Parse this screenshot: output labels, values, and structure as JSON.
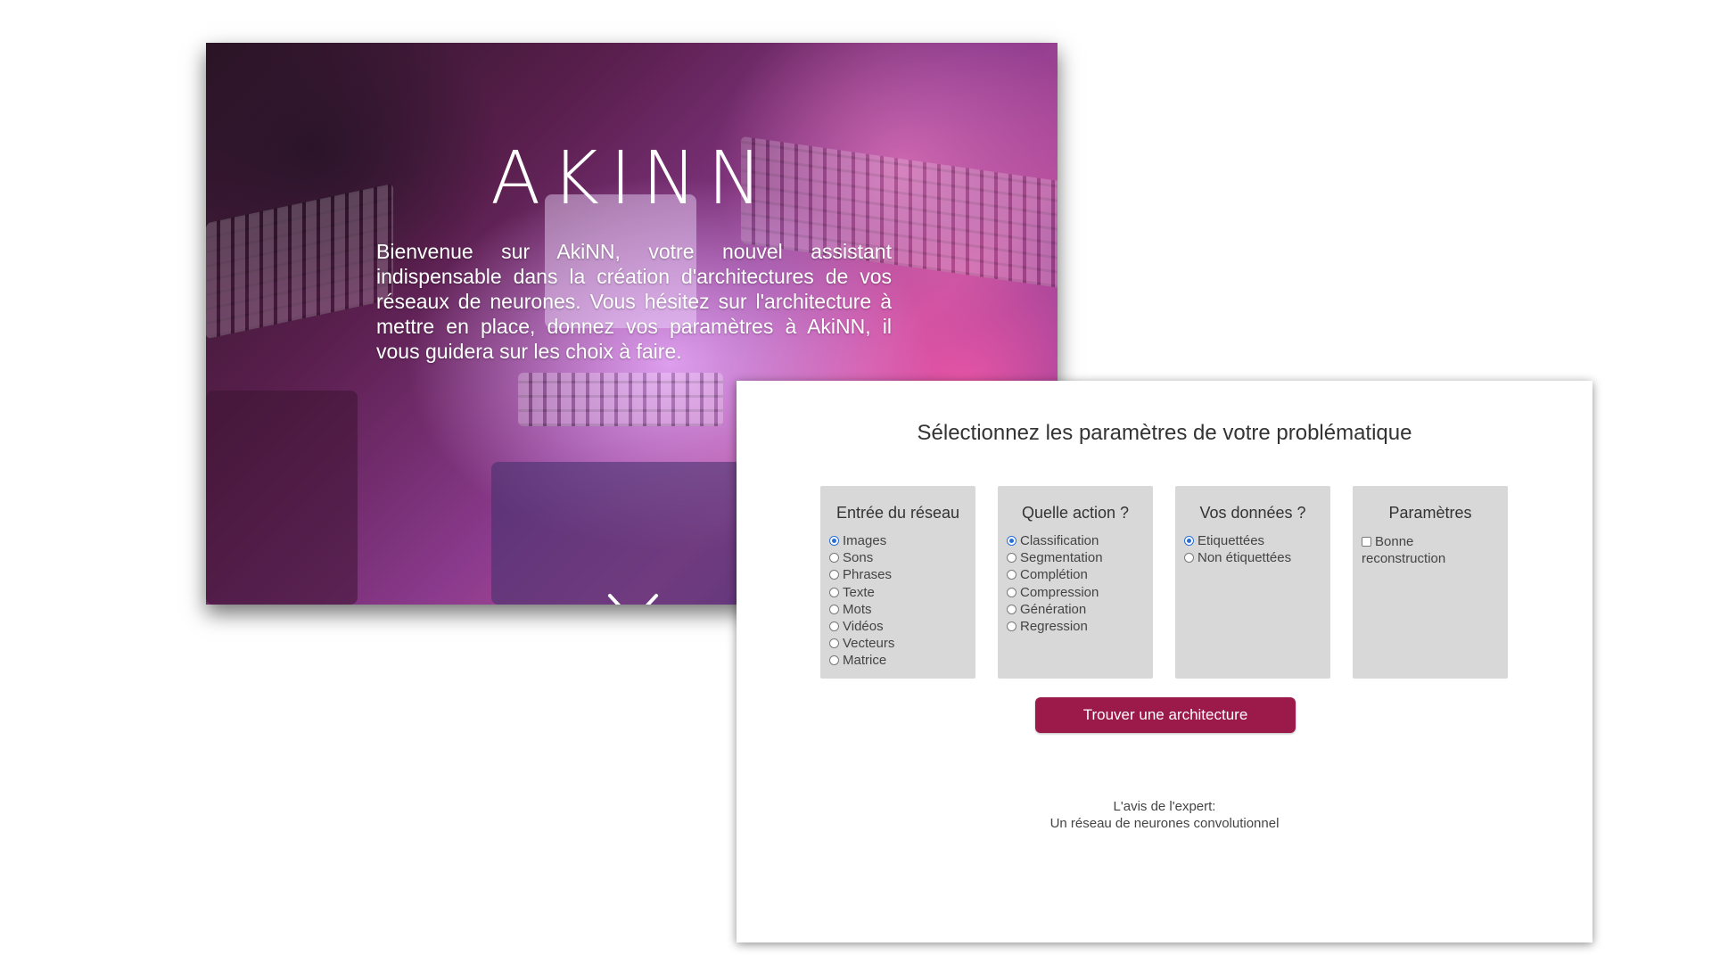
{
  "hero": {
    "logo": "AKINN",
    "intro": "Bienvenue sur AkiNN, votre nouvel assistant indispensable dans la création d'architectures de vos réseaux de neurones. Vous hésitez sur l'architecture à mettre en place, donnez vos paramètres à AkiNN, il vous guidera sur les choix à faire.",
    "scroll_icon": "chevron-down-icon"
  },
  "form": {
    "title": "Sélectionnez les paramètres de votre problématique",
    "groups": [
      {
        "title": "Entrée du réseau",
        "type": "radio",
        "selected": "Images",
        "options": [
          "Images",
          "Sons",
          "Phrases",
          "Texte",
          "Mots",
          "Vidéos",
          "Vecteurs",
          "Matrice"
        ]
      },
      {
        "title": "Quelle action ?",
        "type": "radio",
        "selected": "Classification",
        "options": [
          "Classification",
          "Segmentation",
          "Complétion",
          "Compression",
          "Génération",
          "Regression"
        ]
      },
      {
        "title": "Vos données ?",
        "type": "radio",
        "selected": "Etiquettées",
        "options": [
          "Etiquettées",
          "Non étiquettées"
        ]
      },
      {
        "title": "Paramètres",
        "type": "checkbox",
        "checked": false,
        "options": [
          "Bonne reconstruction"
        ]
      }
    ],
    "submit_label": "Trouver une architecture"
  },
  "expert": {
    "label": "L'avis de l'expert:",
    "answer": "Un réseau de neurones convolutionnel"
  },
  "colors": {
    "accent": "#9c1a4a",
    "panel_group_bg": "#d8d8d8",
    "radio_selected": "#2a6fd6"
  }
}
